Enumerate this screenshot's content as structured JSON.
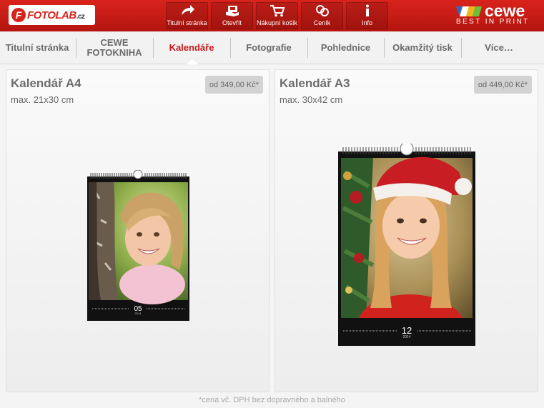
{
  "header": {
    "logo_mark": "F",
    "logo_text": "FOTOLAB",
    "logo_suffix": ".cz",
    "toolbar": [
      {
        "label": "Titulní stránka",
        "icon": "home-arrow-icon"
      },
      {
        "label": "Otevřít",
        "icon": "open-hand-icon"
      },
      {
        "label": "Nákupní košík",
        "icon": "cart-icon"
      },
      {
        "label": "Ceník",
        "icon": "coins-icon"
      },
      {
        "label": "Info",
        "icon": "info-icon"
      }
    ],
    "brand_word": "cewe",
    "brand_tagline": "BEST IN PRINT"
  },
  "nav": {
    "tabs": [
      {
        "label": "Titulní stránka"
      },
      {
        "label": "CEWE FOTOKNIHA"
      },
      {
        "label": "Kalendáře"
      },
      {
        "label": "Fotografie"
      },
      {
        "label": "Pohlednice"
      },
      {
        "label": "Okamžitý tisk"
      },
      {
        "label": "Více…"
      }
    ],
    "active_index": 2
  },
  "products": [
    {
      "title": "Kalendář A4",
      "subtitle": "max. 21x30 cm",
      "price": "od 349,00 Kč*",
      "month": "05",
      "year": "2014"
    },
    {
      "title": "Kalendář A3",
      "subtitle": "max. 30x42 cm",
      "price": "od 449,00 Kč*",
      "month": "12",
      "year": "2014"
    }
  ],
  "footer_note": "*cena vč. DPH bez dopravného a balného",
  "colors": {
    "brand_red": "#c8181a",
    "topbar": "#d8231c"
  }
}
